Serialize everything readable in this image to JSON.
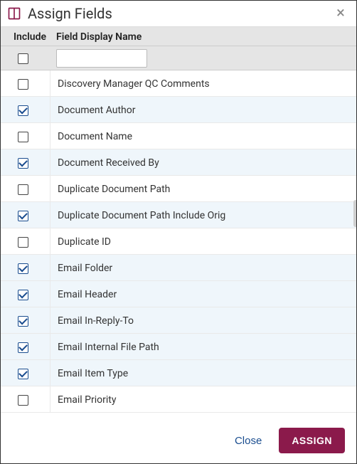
{
  "header": {
    "title": "Assign Fields"
  },
  "columns": {
    "include": "Include",
    "name": "Field Display Name"
  },
  "filter": {
    "name_value": ""
  },
  "rows": [
    {
      "checked": false,
      "name": "Discovery Manager QC Comments"
    },
    {
      "checked": true,
      "name": "Document Author"
    },
    {
      "checked": false,
      "name": "Document Name"
    },
    {
      "checked": true,
      "name": "Document Received By"
    },
    {
      "checked": false,
      "name": "Duplicate Document Path"
    },
    {
      "checked": true,
      "name": "Duplicate Document Path Include Orig"
    },
    {
      "checked": false,
      "name": "Duplicate ID"
    },
    {
      "checked": true,
      "name": "Email Folder"
    },
    {
      "checked": true,
      "name": "Email Header"
    },
    {
      "checked": true,
      "name": "Email In-Reply-To"
    },
    {
      "checked": true,
      "name": "Email Internal File Path"
    },
    {
      "checked": true,
      "name": "Email Item Type"
    },
    {
      "checked": false,
      "name": "Email Priority"
    }
  ],
  "footer": {
    "close": "Close",
    "assign": "ASSIGN"
  }
}
